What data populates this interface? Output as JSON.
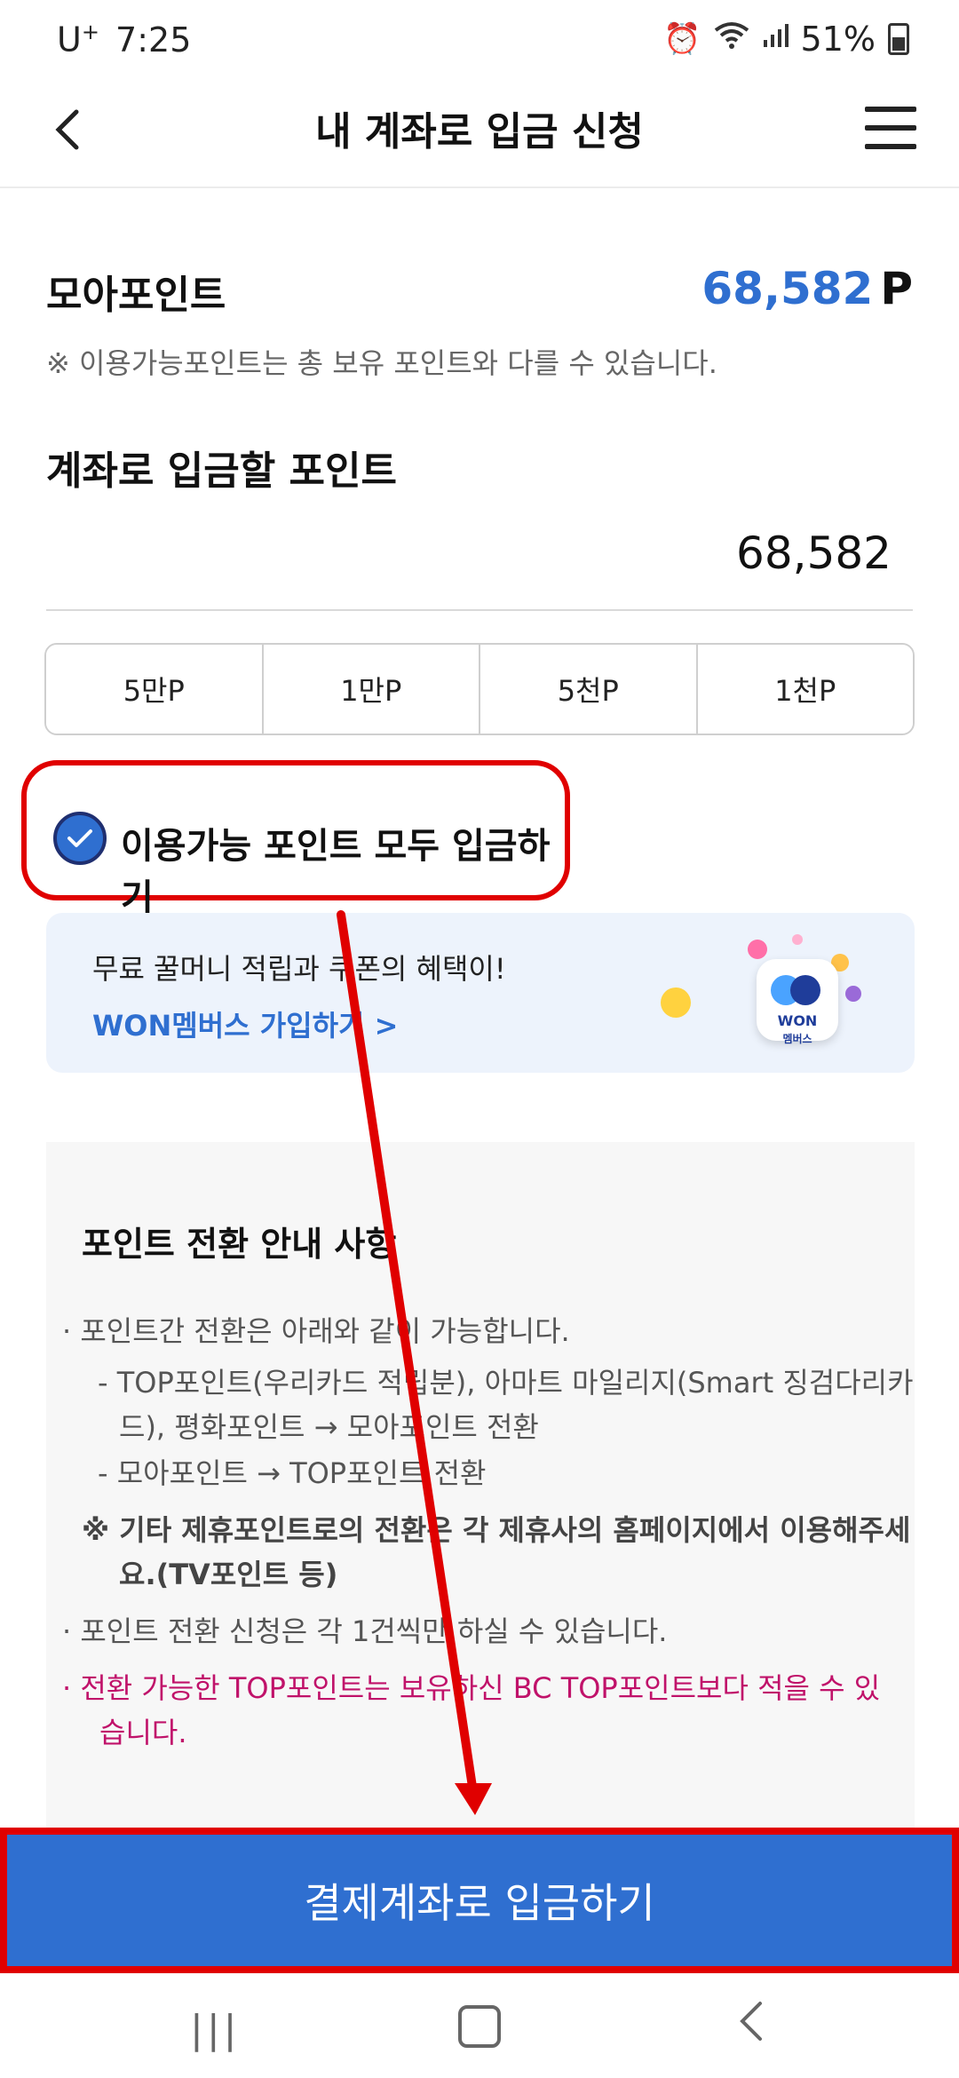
{
  "status_bar": {
    "carrier": "U",
    "carrier_mark": "+",
    "time": "7:25",
    "battery": "51%"
  },
  "header": {
    "title": "내 계좌로 입금 신청"
  },
  "points": {
    "label": "모아포인트",
    "value": "68,582",
    "unit": "P",
    "note": "※  이용가능포인트는 총 보유 포인트와 다를 수 있습니다."
  },
  "deposit": {
    "label": "계좌로 입금할 포인트",
    "amount": "68,582"
  },
  "quick_amounts": [
    "5만P",
    "1만P",
    "5천P",
    "1천P"
  ],
  "deposit_all": {
    "label": "이용가능 포인트 모두 입금하기",
    "checked": true
  },
  "banner": {
    "text": "무료 꿀머니 적립과 쿠폰의 혜택이!",
    "link": "WON멤버스 가입하기 >",
    "app_label": "WON",
    "app_sub": "멤버스"
  },
  "info": {
    "title": "포인트 전환 안내 사항",
    "items": [
      "·  포인트간 전환은 아래와 같이 가능합니다.",
      "- TOP포인트(우리카드 적립분), 아마트 마일리지(Smart 징검다리카",
      "드), 평화포인트 → 모아포인트 전환",
      "- 모아포인트 → TOP포인트 전환",
      "※  기타 제휴포인트로의 전환은 각 제휴사의 홈페이지에서 이용해주세",
      "요.(TV포인트 등)",
      "·  포인트 전환 신청은 각 1건씩만 하실 수 있습니다.",
      "·  전환 가능한 TOP포인트는 보유하신 BC TOP포인트보다 적을 수 있",
      "습니다."
    ]
  },
  "cta": {
    "label": "결제계좌로 입금하기"
  },
  "colors": {
    "accent": "#2f6fd0",
    "highlight": "#e00000",
    "warning": "#c0126a"
  }
}
